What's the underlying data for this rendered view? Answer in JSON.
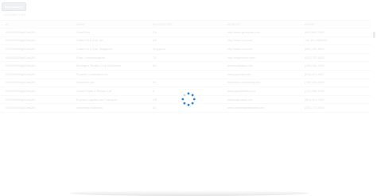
{
  "toolbar": {
    "button_label": "New Account"
  },
  "section": {
    "label": "ACCOUNT LIST"
  },
  "table": {
    "columns": [
      "ID",
      "NAME",
      "BILLINGSTATE",
      "WEBSITE",
      "PHONE"
    ],
    "rows": [
      [
        "0010000000gKDmAAG",
        "GenePoint",
        "CA",
        "http://www.genepoint.com",
        "(650) 867-3450"
      ],
      [
        "0010000000gKDmAAG",
        "United Oil & Gas, UK",
        "UK",
        "http://www.uos.com",
        "+44 191 4956203"
      ],
      [
        "0010000000gKDmAAG",
        "United Oil & Gas, Singapore",
        "Singapore",
        "http://www.uos.com",
        "(650) 450-8810"
      ],
      [
        "0010000000gKDmAAG",
        "Edge Communications",
        "TX",
        "http://edgecomm.com",
        "(512) 757-6000"
      ],
      [
        "0010000000gKDmAAG",
        "Burlington Textiles Corp of America",
        "NC",
        "www.burlington.com",
        "(336) 222-7000"
      ],
      [
        "0010000000gKDmAAG",
        "Pyramid Construction Inc.",
        "",
        "www.pyramid.com",
        "(014) 427-4427"
      ],
      [
        "0010000000gKDmAAG",
        "Dickenson plc",
        "KS",
        "dickenson-consulting.com",
        "(785) 241-6200"
      ],
      [
        "0010000000gKDmAAG",
        "Grand Hotels & Resorts Ltd",
        "IL",
        "www.grandhotels.com",
        "(312) 596-1000"
      ],
      [
        "0010000000gKDmAAG",
        "Express Logistics and Transport",
        "OR",
        "www.expressl&t.net",
        "(503) 421-7800"
      ],
      [
        "0010000000gKDmAAG",
        "University of Arizona",
        "AZ",
        "www.universityofarizona.com",
        "(520) 773-9050"
      ]
    ]
  },
  "colors": {
    "spinner": "#2b84d6",
    "button_bg": "#d9dde3"
  },
  "icons": {
    "loading": "loading-spinner-icon"
  }
}
